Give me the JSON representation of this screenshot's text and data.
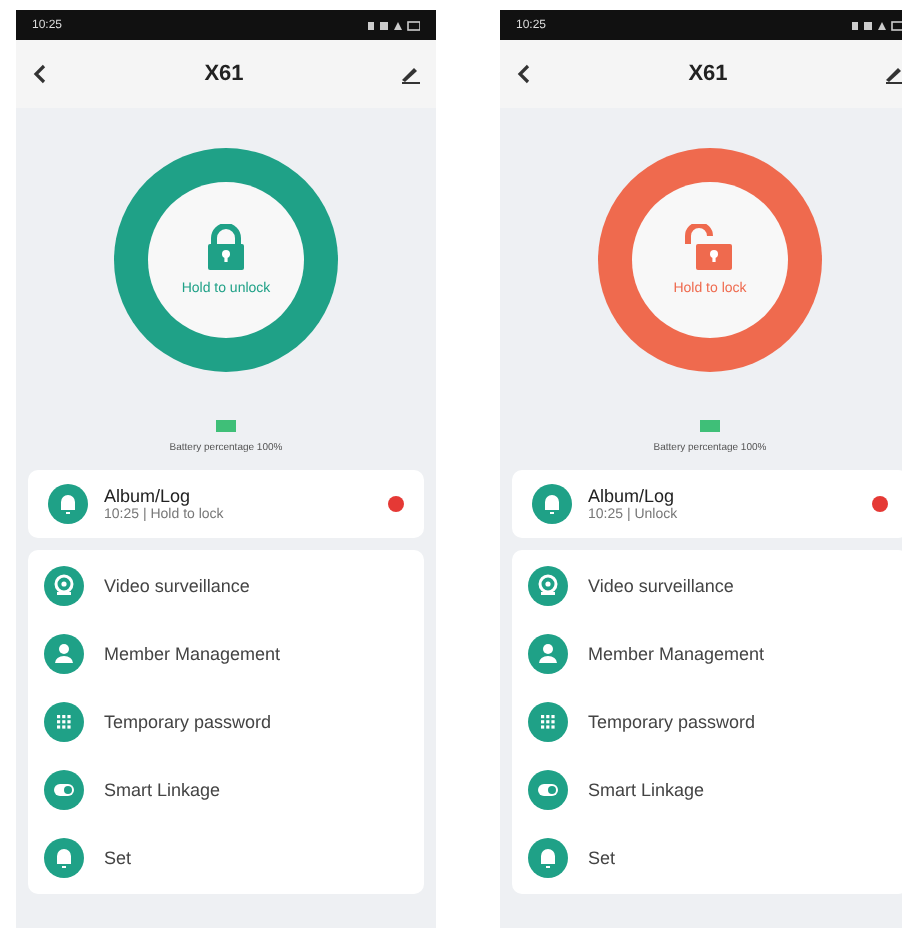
{
  "phones": [
    {
      "status_time": "10:25",
      "title": "X61",
      "lock": {
        "locked": true,
        "label": "Hold to unlock"
      },
      "battery": {
        "text": "Battery percentage 100%"
      },
      "log": {
        "title": "Album/Log",
        "subtitle": "10:25 | Hold to lock"
      },
      "menu": [
        {
          "kind": "camera",
          "label": "Video surveillance"
        },
        {
          "kind": "person",
          "label": "Member Management"
        },
        {
          "kind": "keypad",
          "label": "Temporary password"
        },
        {
          "kind": "toggle",
          "label": "Smart Linkage"
        },
        {
          "kind": "bell",
          "label": "Set"
        }
      ]
    },
    {
      "status_time": "10:25",
      "title": "X61",
      "lock": {
        "locked": false,
        "label": "Hold to lock"
      },
      "battery": {
        "text": "Battery percentage 100%"
      },
      "log": {
        "title": "Album/Log",
        "subtitle": "10:25 | Unlock"
      },
      "menu": [
        {
          "kind": "camera",
          "label": "Video surveillance"
        },
        {
          "kind": "person",
          "label": "Member Management"
        },
        {
          "kind": "keypad",
          "label": "Temporary password"
        },
        {
          "kind": "toggle",
          "label": "Smart Linkage"
        },
        {
          "kind": "bell",
          "label": "Set"
        }
      ]
    }
  ]
}
